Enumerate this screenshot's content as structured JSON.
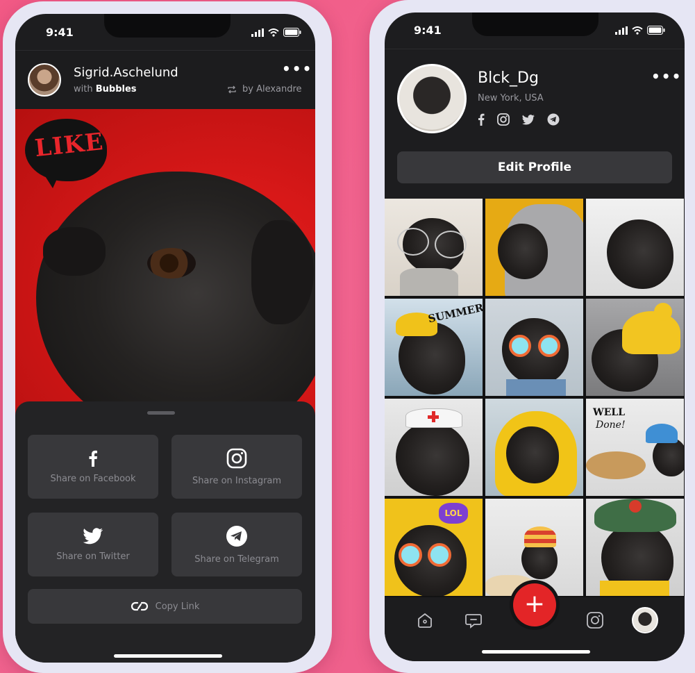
{
  "left_phone": {
    "status_time": "9:41",
    "post": {
      "user_name": "Sigrid.Aschelund",
      "with_prefix": "with",
      "with_name": "Bubbles",
      "repost_by": "by Alexandre",
      "more_icon": "ellipsis-icon"
    },
    "sticker_text": "LIKE",
    "share_sheet": {
      "buttons": [
        {
          "label": "Share on Facebook",
          "icon": "facebook-icon"
        },
        {
          "label": "Share on Instagram",
          "icon": "instagram-icon"
        },
        {
          "label": "Share on Twitter",
          "icon": "twitter-icon"
        },
        {
          "label": "Share on Telegram",
          "icon": "telegram-icon"
        }
      ],
      "copy_link_label": "Copy Link"
    }
  },
  "right_phone": {
    "status_time": "9:41",
    "profile": {
      "name": "Blck_Dg",
      "location": "New York, USA",
      "socials": [
        "facebook-icon",
        "instagram-icon",
        "twitter-icon",
        "telegram-icon"
      ],
      "edit_label": "Edit Profile"
    },
    "grid_stickers": {
      "summer": "SUMMER",
      "well_done_1": "WELL",
      "well_done_2": "Done!",
      "lol": "LOL"
    },
    "tabbar": [
      "home-icon",
      "messages-icon",
      "add-icon",
      "instagram-icon",
      "profile-avatar"
    ]
  },
  "colors": {
    "background": "#f25a86",
    "accent_red": "#e32527",
    "dark_surface": "#1d1d1f",
    "button_surface": "#38383b"
  }
}
